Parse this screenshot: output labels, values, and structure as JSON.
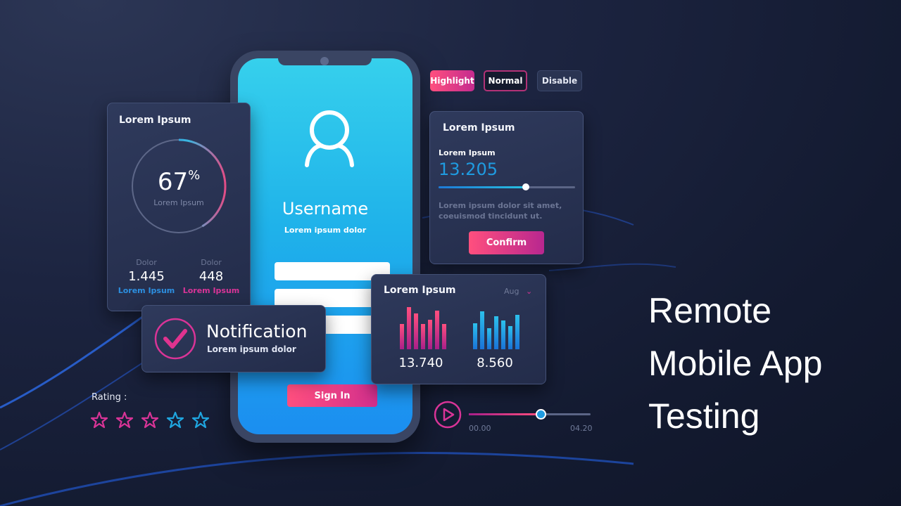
{
  "headline": {
    "lines": [
      "Remote",
      "Mobile App",
      "Testing"
    ]
  },
  "phone": {
    "username_label": "Username",
    "subtitle": "Lorem ipsum dolor",
    "signin_label": "Sign In",
    "icon": "user-icon"
  },
  "buttons": {
    "highlight": "Highlight",
    "normal": "Normal",
    "disable": "Disable"
  },
  "progress_card": {
    "title": "Lorem Ipsum",
    "percent_value": "67",
    "percent_sign": "%",
    "percent_fraction": 0.67,
    "caption": "Lorem Ipsum",
    "stats": [
      {
        "label": "Dolor",
        "value": "1.445",
        "sub": "Lorem Ipsum",
        "color": "#2c8fe0"
      },
      {
        "label": "Dolor",
        "value": "448",
        "sub": "Lorem Ipsum",
        "color": "#d93497"
      }
    ]
  },
  "slider_card": {
    "title": "Lorem Ipsum",
    "label": "Lorem Ipsum",
    "value": "13.205",
    "slider_fraction": 0.64,
    "description_lines": [
      "Lorem ipsum dolor sit amet,",
      "coeuismod tincidunt ut."
    ],
    "confirm_label": "Confirm"
  },
  "chart_card": {
    "title": "Lorem Ipsum",
    "month": "Aug",
    "left_value": "13.740",
    "right_value": "8.560"
  },
  "notification": {
    "title": "Notification",
    "subtitle": "Lorem ipsum dolor",
    "icon": "check-circle-icon"
  },
  "rating": {
    "label": "Rating :",
    "stars": [
      {
        "color": "#d93497"
      },
      {
        "color": "#d93497"
      },
      {
        "color": "#d93497"
      },
      {
        "color": "#1fa6e0"
      },
      {
        "color": "#1fa6e0"
      }
    ]
  },
  "player": {
    "start_time": "00.00",
    "end_time": "04.20",
    "progress_fraction": 0.59
  },
  "chart_data": [
    {
      "type": "bar",
      "title": "Lorem Ipsum",
      "series": [
        {
          "name": "pink",
          "values": [
            0.6,
            1.0,
            0.85,
            0.6,
            0.7,
            0.92,
            0.6
          ],
          "color": "#ef3f7e",
          "total_label": "13.740"
        },
        {
          "name": "blue",
          "values": [
            0.62,
            0.9,
            0.5,
            0.78,
            0.68,
            0.55,
            0.82
          ],
          "color": "#21a6e8",
          "total_label": "8.560"
        }
      ]
    }
  ],
  "colors": {
    "pink": "#ef3f7e",
    "magenta": "#d22f8d",
    "blue": "#1fa6e0",
    "bg": "#131a30"
  }
}
